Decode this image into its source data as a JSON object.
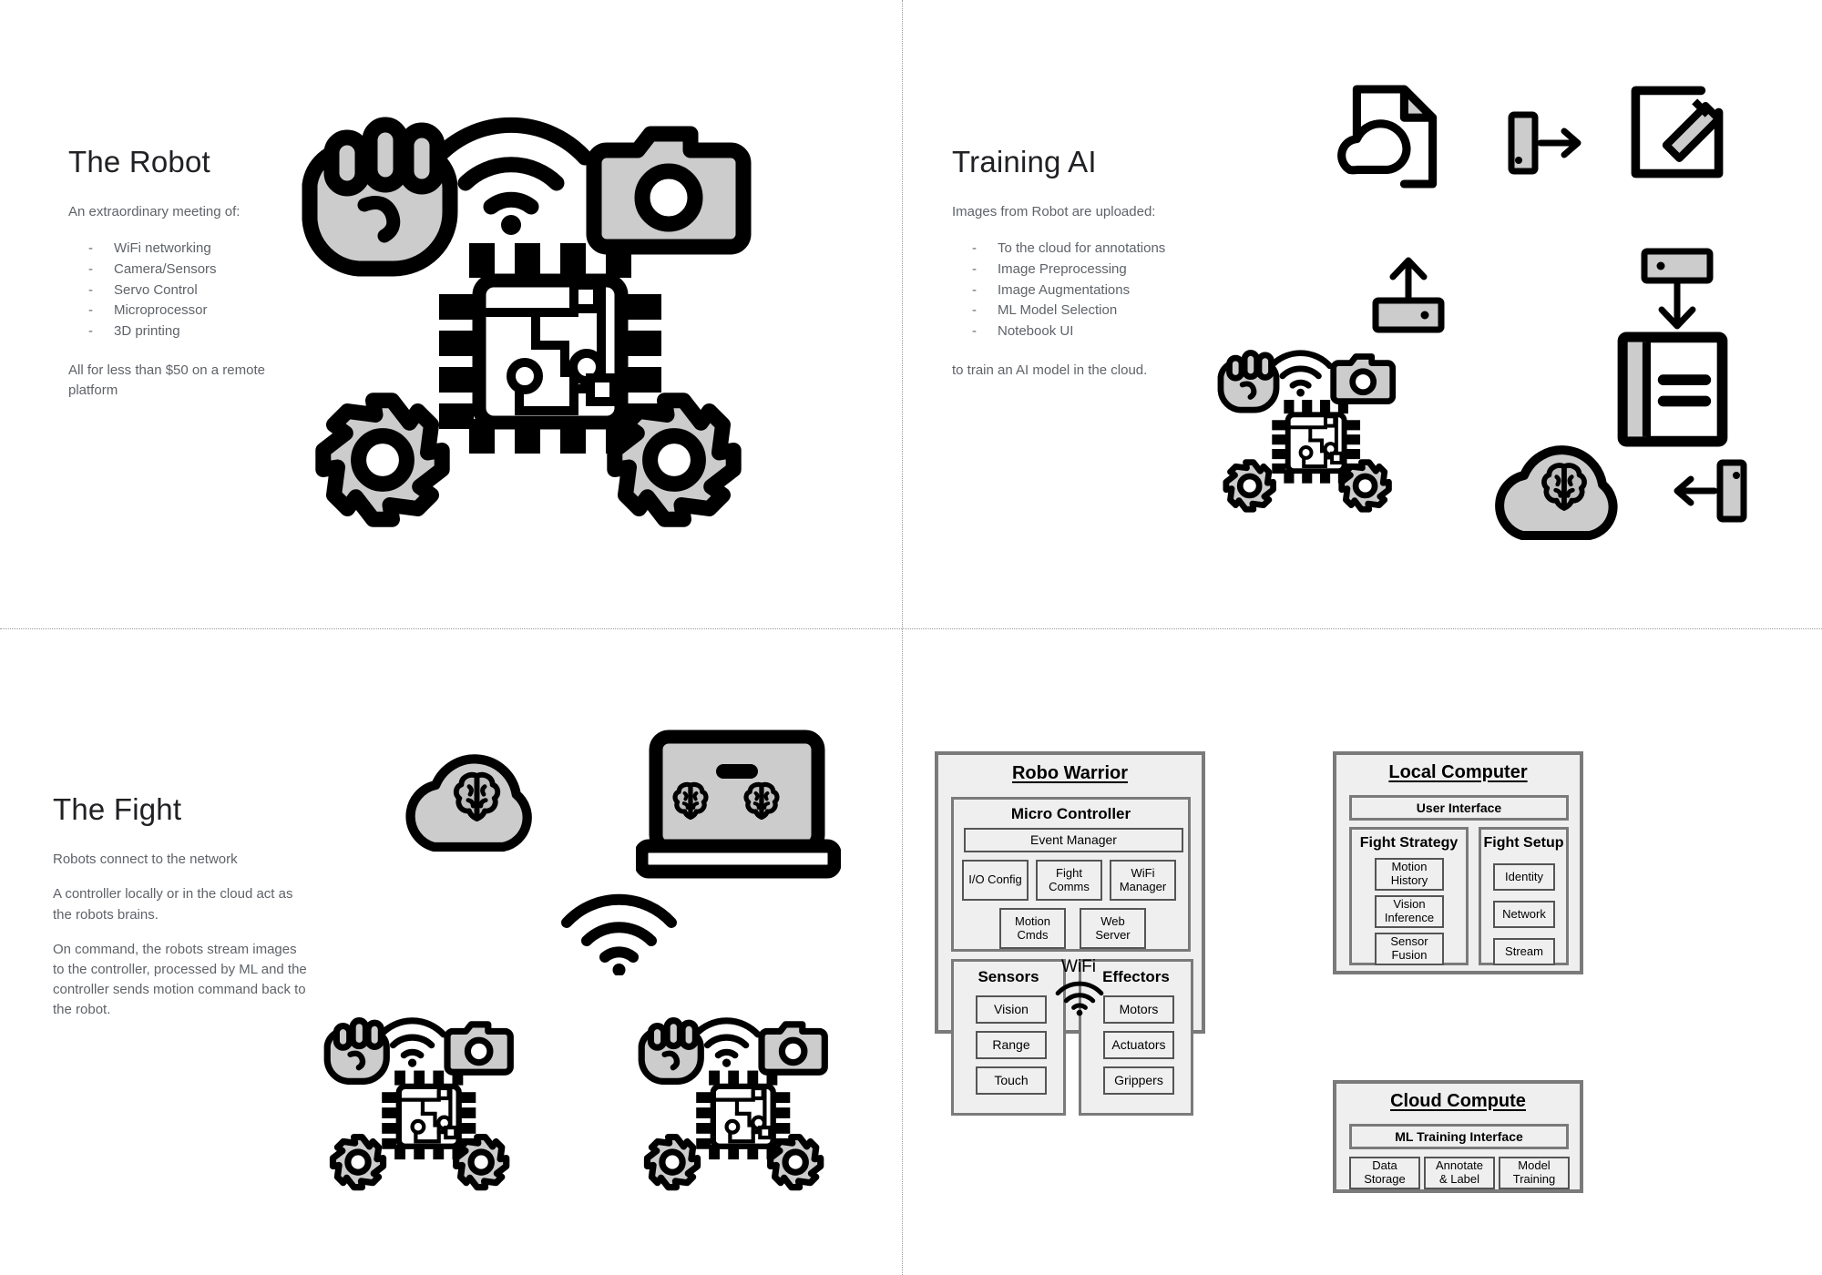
{
  "slides": {
    "robot": {
      "title": "The Robot",
      "lead": "An extraordinary meeting of:",
      "bullets": [
        "WiFi networking",
        "Camera/Sensors",
        "Servo Control",
        "Microprocessor",
        "3D printing"
      ],
      "footer": "All for less than $50 on a remote platform",
      "icons": [
        "fist-icon",
        "wifi-icon",
        "camera-icon",
        "microchip-icon",
        "gear-icon",
        "gear-icon"
      ]
    },
    "training": {
      "title": "Training AI",
      "lead": "Images from Robot are uploaded:",
      "bullets": [
        "To the cloud for annotations",
        "Image Preprocessing",
        "Image Augmentations",
        "ML Model Selection",
        "Notebook UI"
      ],
      "footer": "to train an AI model in the cloud.",
      "icons": [
        "cloud-document-icon",
        "arrow-right-from-bracket-icon",
        "pencil-square-icon",
        "upload-icon",
        "download-icon",
        "notebook-icon",
        "robot-composite-icon",
        "brain-cloud-icon",
        "arrow-left-to-bracket-icon"
      ]
    },
    "fight": {
      "title": "The Fight",
      "paragraphs": [
        "Robots connect to the network",
        "A controller locally or in the cloud act as the robots brains.",
        "On command, the robots stream images to the controller, processed by ML and the controller sends motion command back to the robot."
      ],
      "icons": [
        "brain-cloud-icon",
        "laptop-brain-icon",
        "wifi-icon",
        "robot-composite-icon",
        "robot-composite-icon"
      ]
    }
  },
  "architecture": {
    "robo_warrior": {
      "title": "Robo Warrior",
      "micro_controller": {
        "title": "Micro Controller",
        "event_manager": "Event Manager",
        "row1": [
          "I/O Config",
          "Fight\nComms",
          "WiFi\nManager"
        ],
        "row2": [
          "Motion\nCmds",
          "Web\nServer"
        ]
      },
      "sensors": {
        "title": "Sensors",
        "items": [
          "Vision",
          "Range",
          "Touch"
        ]
      },
      "effectors": {
        "title": "Effectors",
        "items": [
          "Motors",
          "Actuators",
          "Grippers"
        ]
      }
    },
    "link": {
      "label": "WiFi",
      "icon": "wifi-icon"
    },
    "local_computer": {
      "title": "Local Computer",
      "user_interface": "User Interface",
      "fight_strategy": {
        "title": "Fight Strategy",
        "items": [
          "Motion\nHistory",
          "Vision\nInference",
          "Sensor\nFusion"
        ]
      },
      "fight_setup": {
        "title": "Fight Setup",
        "items": [
          "Identity",
          "Network",
          "Stream"
        ]
      }
    },
    "cloud_compute": {
      "title": "Cloud Compute",
      "ml_training_interface": "ML Training Interface",
      "items": [
        "Data\nStorage",
        "Annotate\n& Label",
        "Model\nTraining"
      ]
    }
  },
  "colors": {
    "box_fill": "#efefef",
    "box_border": "#7a7a7a",
    "leaf_border": "#555555",
    "icon_fill": "#cccccc",
    "icon_stroke": "#000000",
    "text_body": "#5f6368",
    "text_title": "#202124"
  }
}
